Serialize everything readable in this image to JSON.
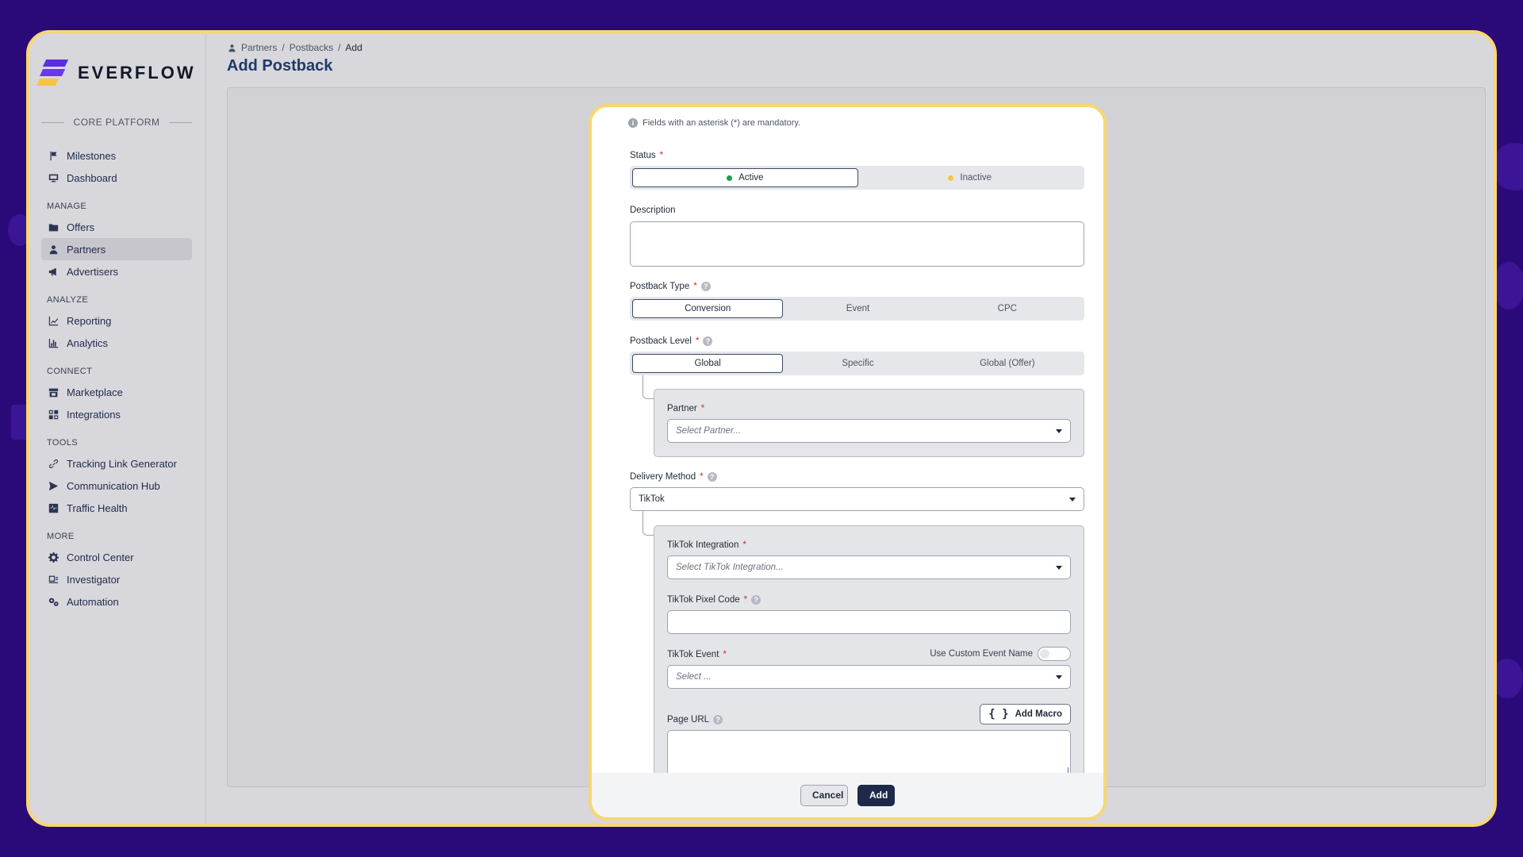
{
  "brand": {
    "name": "EVERFLOW",
    "platform_label": "CORE PLATFORM"
  },
  "sidebar": {
    "top_items": [
      {
        "label": "Milestones",
        "icon": "flag-icon"
      },
      {
        "label": "Dashboard",
        "icon": "monitor-icon"
      }
    ],
    "sections": [
      {
        "heading": "MANAGE",
        "items": [
          {
            "label": "Offers",
            "icon": "folder-icon"
          },
          {
            "label": "Partners",
            "icon": "user-icon",
            "active": true
          },
          {
            "label": "Advertisers",
            "icon": "megaphone-icon"
          }
        ]
      },
      {
        "heading": "ANALYZE",
        "items": [
          {
            "label": "Reporting",
            "icon": "chart-line-icon"
          },
          {
            "label": "Analytics",
            "icon": "chart-bar-icon"
          }
        ]
      },
      {
        "heading": "CONNECT",
        "items": [
          {
            "label": "Marketplace",
            "icon": "store-icon"
          },
          {
            "label": "Integrations",
            "icon": "integrations-icon"
          }
        ]
      },
      {
        "heading": "TOOLS",
        "items": [
          {
            "label": "Tracking Link Generator",
            "icon": "link-icon"
          },
          {
            "label": "Communication Hub",
            "icon": "send-icon"
          },
          {
            "label": "Traffic Health",
            "icon": "heartbeat-icon"
          }
        ]
      },
      {
        "heading": "MORE",
        "items": [
          {
            "label": "Control Center",
            "icon": "gear-icon"
          },
          {
            "label": "Investigator",
            "icon": "investigator-icon"
          },
          {
            "label": "Automation",
            "icon": "cogs-icon"
          }
        ]
      }
    ]
  },
  "breadcrumb": {
    "items": [
      "Partners",
      "Postbacks",
      "Add"
    ],
    "separator": "/"
  },
  "page": {
    "title": "Add Postback"
  },
  "form": {
    "mandatory_note": "Fields with an asterisk (*) are mandatory.",
    "required_marker": "*",
    "help_glyph": "?",
    "info_glyph": "i",
    "status": {
      "label": "Status",
      "options": [
        "Active",
        "Inactive"
      ],
      "selected": "Active",
      "active_color": "#16a34a",
      "inactive_color": "#f6c543"
    },
    "description": {
      "label": "Description",
      "value": ""
    },
    "postback_type": {
      "label": "Postback Type",
      "options": [
        "Conversion",
        "Event",
        "CPC"
      ],
      "selected": "Conversion"
    },
    "postback_level": {
      "label": "Postback Level",
      "options": [
        "Global",
        "Specific",
        "Global (Offer)"
      ],
      "selected": "Global"
    },
    "partner": {
      "label": "Partner",
      "placeholder": "Select Partner..."
    },
    "delivery_method": {
      "label": "Delivery Method",
      "value": "TikTok"
    },
    "tiktok_integration": {
      "label": "TikTok Integration",
      "placeholder": "Select TikTok Integration..."
    },
    "tiktok_pixel_code": {
      "label": "TikTok Pixel Code",
      "value": ""
    },
    "tiktok_event": {
      "label": "TikTok Event",
      "placeholder": "Select ...",
      "custom_toggle_label": "Use Custom Event Name",
      "custom_toggle_on": false
    },
    "page_url": {
      "label": "Page URL",
      "value": "",
      "add_macro_label": "Add Macro",
      "macro_glyph": "{ }"
    }
  },
  "footer": {
    "cancel_label": "Cancel",
    "add_label": "Add"
  },
  "colors": {
    "background": "#2a0a78",
    "frame_border": "#f7d774",
    "accent_navy": "#1e2a4a",
    "title": "#1e3a6b"
  }
}
